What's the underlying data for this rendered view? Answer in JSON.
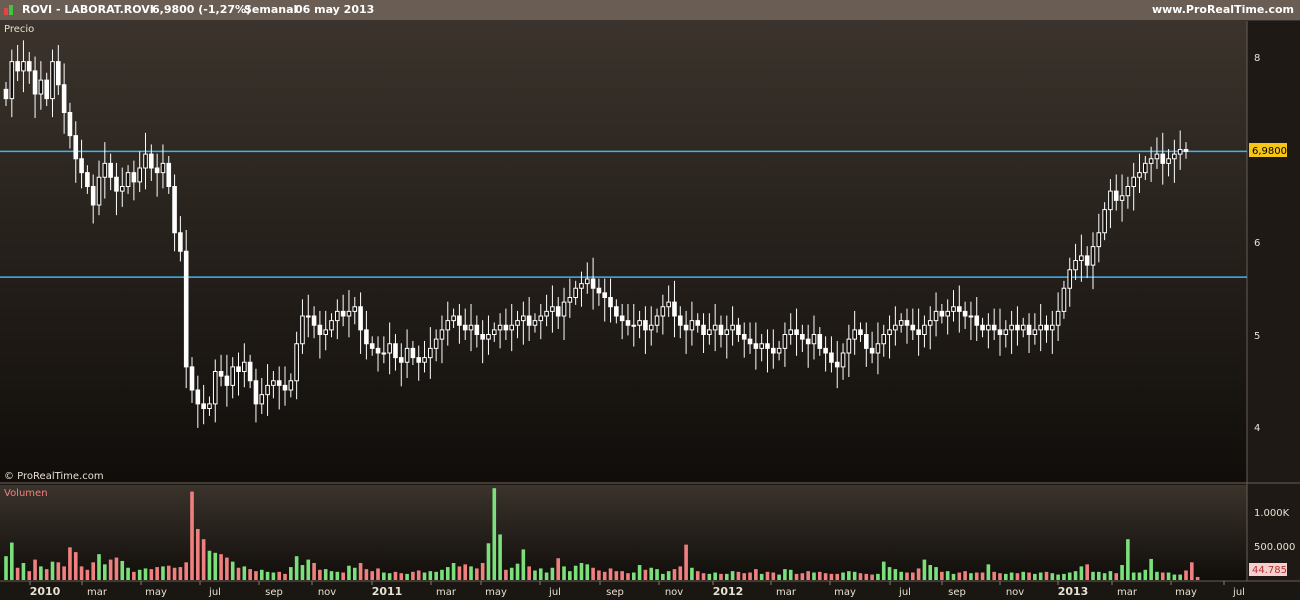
{
  "header": {
    "title": "ROVI - LABORAT.ROVI",
    "price": "6,9800 (-1,27%)",
    "period": "Semanal",
    "date": "06 may 2013",
    "site": "www.ProRealTime.com"
  },
  "price_panel": {
    "label": "Precio",
    "copyright": "© ProRealTime.com",
    "last_price_tag": "6,9800"
  },
  "volume_panel": {
    "label": "Volumen",
    "last_volume_tag": "44.785"
  },
  "colors": {
    "background_top": "#3b332c",
    "background_bottom": "#100d0a",
    "candle": "#ffffff",
    "hline": "#3fb4f0",
    "volume_up": "#7be07b",
    "volume_down": "#f08080",
    "price_tag": "#f5c518"
  },
  "chart_data": [
    {
      "type": "candlestick",
      "ylim": [
        3.5,
        8.4
      ],
      "y_ticks": [
        "8",
        "6",
        "5",
        "4"
      ],
      "x_ticks": [
        "2010",
        "mar",
        "may",
        "jul",
        "sep",
        "nov",
        "2011",
        "mar",
        "may",
        "jul",
        "sep",
        "nov",
        "2012",
        "mar",
        "may",
        "jul",
        "sep",
        "nov",
        "2013",
        "mar",
        "may",
        "jul"
      ],
      "horizontal_lines": [
        6.98,
        5.62
      ],
      "series": [
        {
          "values": [
            7.55,
            7.95,
            7.85,
            7.95,
            7.85,
            7.6,
            7.75,
            7.55,
            7.95,
            7.7,
            7.4,
            7.15,
            6.9,
            6.75,
            6.6,
            6.4,
            6.7,
            6.85,
            6.7,
            6.55,
            6.6,
            6.75,
            6.65,
            6.8,
            6.95,
            6.8,
            6.75,
            6.85,
            6.6,
            6.1,
            5.9,
            4.65,
            4.4,
            4.25,
            4.2,
            4.25,
            4.6,
            4.55,
            4.45,
            4.65,
            4.6,
            4.7,
            4.5,
            4.25,
            4.35,
            4.45,
            4.5,
            4.45,
            4.4,
            4.5,
            4.9,
            5.2,
            5.2,
            5.1,
            5.0,
            5.05,
            5.15,
            5.25,
            5.2,
            5.25,
            5.3,
            5.05,
            4.9,
            4.85,
            4.8,
            4.8,
            4.9,
            4.75,
            4.7,
            4.85,
            4.75,
            4.7,
            4.75,
            4.85,
            4.95,
            5.05,
            5.15,
            5.2,
            5.1,
            5.05,
            5.1,
            5.0,
            4.95,
            5.0,
            5.05,
            5.1,
            5.05,
            5.1,
            5.15,
            5.2,
            5.1,
            5.15,
            5.2,
            5.25,
            5.3,
            5.2,
            5.35,
            5.4,
            5.5,
            5.55,
            5.6,
            5.5,
            5.45,
            5.4,
            5.3,
            5.2,
            5.15,
            5.1,
            5.1,
            5.15,
            5.05,
            5.1,
            5.2,
            5.3,
            5.35,
            5.2,
            5.1,
            5.05,
            5.15,
            5.1,
            5.0,
            5.05,
            5.1,
            5.0,
            5.05,
            5.1,
            5.0,
            4.95,
            4.9,
            4.85,
            4.9,
            4.85,
            4.8,
            4.85,
            5.0,
            5.05,
            5.0,
            4.95,
            4.9,
            5.0,
            4.85,
            4.8,
            4.7,
            4.65,
            4.8,
            4.95,
            5.05,
            5.0,
            4.85,
            4.8,
            4.9,
            5.0,
            5.05,
            5.1,
            5.15,
            5.1,
            5.05,
            5.0,
            5.1,
            5.15,
            5.25,
            5.2,
            5.25,
            5.3,
            5.25,
            5.2,
            5.2,
            5.1,
            5.05,
            5.1,
            5.05,
            5.0,
            5.05,
            5.1,
            5.05,
            5.1,
            5.0,
            5.05,
            5.1,
            5.05,
            5.1,
            5.25,
            5.5,
            5.7,
            5.8,
            5.85,
            5.75,
            5.95,
            6.1,
            6.35,
            6.55,
            6.45,
            6.5,
            6.6,
            6.7,
            6.75,
            6.85,
            6.9,
            6.95,
            6.85,
            6.9,
            6.95,
            7.0,
            6.98
          ]
        }
      ]
    },
    {
      "type": "bar",
      "ylim": [
        0,
        1500
      ],
      "y_ticks": [
        "1.000K",
        "500.000"
      ],
      "series": [
        {
          "values": [
            350,
            550,
            180,
            250,
            130,
            300,
            200,
            160,
            270,
            260,
            200,
            480,
            410,
            200,
            150,
            260,
            380,
            230,
            300,
            330,
            280,
            180,
            120,
            150,
            170,
            160,
            190,
            200,
            210,
            180,
            190,
            260,
            1300,
            750,
            600,
            430,
            400,
            380,
            330,
            270,
            180,
            200,
            160,
            130,
            150,
            120,
            110,
            120,
            90,
            190,
            350,
            220,
            300,
            250,
            150,
            160,
            130,
            120,
            110,
            210,
            180,
            250,
            160,
            130,
            170,
            110,
            100,
            120,
            100,
            90,
            120,
            140,
            110,
            130,
            120,
            150,
            190,
            250,
            200,
            230,
            200,
            170,
            250,
            540,
            1350,
            670,
            150,
            180,
            240,
            450,
            200,
            140,
            170,
            110,
            180,
            320,
            200,
            130,
            210,
            250,
            230,
            180,
            140,
            120,
            170,
            130,
            130,
            100,
            110,
            220,
            150,
            180,
            160,
            90,
            130,
            160,
            200,
            520,
            180,
            130,
            100,
            90,
            110,
            90,
            90,
            130,
            120,
            100,
            110,
            160,
            90,
            120,
            110,
            80,
            160,
            150,
            90,
            100,
            130,
            110,
            120,
            100,
            90,
            90,
            110,
            130,
            120,
            100,
            90,
            80,
            90,
            270,
            190,
            160,
            120,
            110,
            110,
            170,
            300,
            220,
            190,
            120,
            130,
            90,
            110,
            130,
            100,
            110,
            110,
            230,
            120,
            100,
            90,
            110,
            100,
            120,
            110,
            90,
            110,
            120,
            100,
            80,
            90,
            110,
            130,
            200,
            230,
            120,
            120,
            100,
            130,
            100,
            220,
            600,
            110,
            110,
            150,
            310,
            120,
            110,
            110,
            80,
            80,
            140,
            260,
            44.785
          ]
        }
      ]
    }
  ]
}
